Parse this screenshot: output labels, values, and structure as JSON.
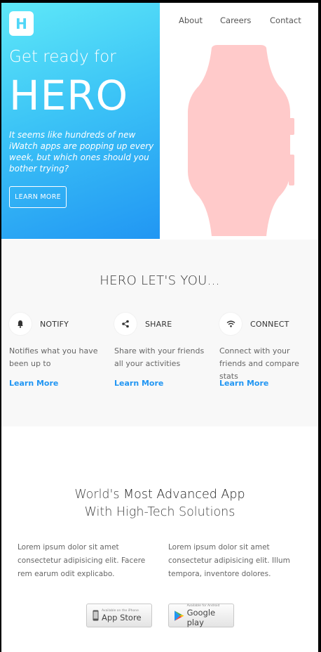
{
  "brand": {
    "logo_letter": "H"
  },
  "nav": {
    "about": "About",
    "careers": "Careers",
    "contact": "Contact"
  },
  "hero": {
    "pre_title": "Get ready for",
    "title": "HERO",
    "tagline": "It seems like hundreds of new iWatch apps are popping up every week, but which ones should you bother trying?",
    "cta_label": "LEARN MORE"
  },
  "features": {
    "heading": "HERO LET'S YOU...",
    "items": [
      {
        "icon": "bell-icon",
        "name": "NOTIFY",
        "desc": "Notifies what you have been up to",
        "link": "Learn More"
      },
      {
        "icon": "share-icon",
        "name": "SHARE",
        "desc": "Share with your friends all your activities",
        "link": "Learn More"
      },
      {
        "icon": "wifi-icon",
        "name": "CONNECT",
        "desc": "Connect with your friends and compare stats",
        "link": "Learn More"
      }
    ]
  },
  "app": {
    "heading_pre": "World's ",
    "heading_strong": "Most Advanced App",
    "heading_line2": "With High-Tech Solutions",
    "col1": "Lorem ipsum dolor sit amet consectetur adipisicing elit. Facere rem earum odit explicabo.",
    "col2": "Lorem ipsum dolor sit amet consectetur adipisicing elit. Illum tempora, inventore dolores.",
    "appstore_small": "Available on the iPhone",
    "appstore_big": "App Store",
    "googleplay_small": "Available for Android",
    "googleplay_big": "Google play"
  },
  "colors": {
    "accent": "#2196f3",
    "hero_gradient_start": "#5ee8f8",
    "watch": "#ffcaca"
  }
}
